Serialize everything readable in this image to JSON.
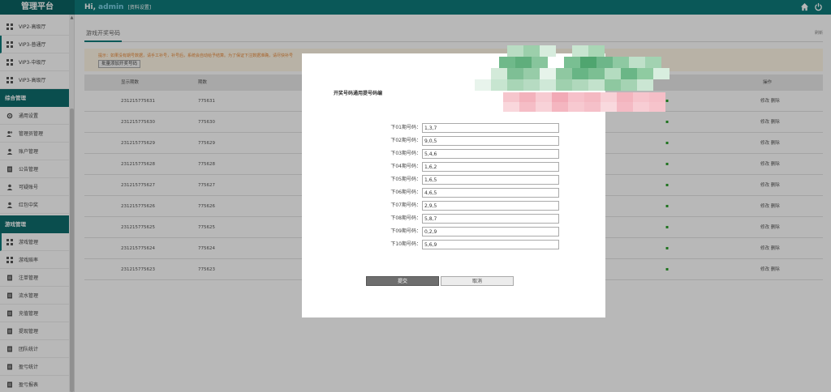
{
  "header": {
    "logo": "管理平台",
    "greeting": "Hi,",
    "username": "admin",
    "profile_link": "[资料设置]"
  },
  "sidebar": {
    "items_top": [
      {
        "label": "VIP2-高级厅",
        "icon": "grid-icon"
      },
      {
        "label": "VIP3-普通厅",
        "icon": "grid-icon",
        "active": true
      },
      {
        "label": "VIP3-中级厅",
        "icon": "grid-icon"
      },
      {
        "label": "VIP3-高级厅",
        "icon": "grid-icon"
      }
    ],
    "section1": "综合管理",
    "items_mid": [
      {
        "label": "通用设置",
        "icon": "gear-icon"
      },
      {
        "label": "管理员管理",
        "icon": "users-icon"
      },
      {
        "label": "账户管理",
        "icon": "user-icon"
      },
      {
        "label": "公告管理",
        "icon": "document-icon"
      },
      {
        "label": "可疑账号",
        "icon": "user-icon"
      },
      {
        "label": "红包中奖",
        "icon": "user-icon"
      }
    ],
    "section2": "游戏管理",
    "items_bottom": [
      {
        "label": "游戏管理",
        "icon": "grid-icon",
        "active": true
      },
      {
        "label": "游戏赔率",
        "icon": "grid-icon"
      },
      {
        "label": "注单管理",
        "icon": "document-icon"
      },
      {
        "label": "流水管理",
        "icon": "document-icon"
      },
      {
        "label": "充值管理",
        "icon": "document-icon"
      },
      {
        "label": "提现管理",
        "icon": "document-icon"
      },
      {
        "label": "团队统计",
        "icon": "document-icon"
      },
      {
        "label": "盈亏统计",
        "icon": "document-icon"
      },
      {
        "label": "盈亏报表",
        "icon": "document-icon"
      }
    ]
  },
  "main": {
    "tab": "游戏开奖号码",
    "refresh": "刷新",
    "tip": "提示：如果没有期号数据，请手工补号，补号后，系统会自动给予结算。为了保证下注数据准确，请尽快补号",
    "batch_button": "批量添加开奖号码",
    "columns": [
      "显示期数",
      "期数",
      "操作"
    ],
    "actions": "修改 删除",
    "rows": [
      {
        "display": "231215775631",
        "period": "775631",
        "state": "▪"
      },
      {
        "display": "231215775630",
        "period": "775630",
        "state": "▪"
      },
      {
        "display": "231215775629",
        "period": "775629",
        "state": "▪"
      },
      {
        "display": "231215775628",
        "period": "775628",
        "state": "▪"
      },
      {
        "display": "231215775627",
        "period": "775627",
        "state": "▪"
      },
      {
        "display": "231215775626",
        "period": "775626",
        "state": "▪"
      },
      {
        "display": "231215775625",
        "period": "775625",
        "state": "▪"
      },
      {
        "display": "231215775624",
        "period": "775624",
        "state": "▪"
      },
      {
        "display": "231215775623",
        "period": "775623",
        "state": "▪"
      }
    ]
  },
  "modal": {
    "title": "开奖号码通用提号码编",
    "fields": [
      {
        "label": "下01期号码：",
        "value": "1,3,7"
      },
      {
        "label": "下02期号码：",
        "value": "9,0,5"
      },
      {
        "label": "下03期号码：",
        "value": "5,4,6"
      },
      {
        "label": "下04期号码：",
        "value": "1,6,2"
      },
      {
        "label": "下05期号码：",
        "value": "1,6,5"
      },
      {
        "label": "下06期号码：",
        "value": "4,6,5"
      },
      {
        "label": "下07期号码：",
        "value": "2,9,5"
      },
      {
        "label": "下08期号码：",
        "value": "5,8,7"
      },
      {
        "label": "下09期号码：",
        "value": "0,2,9"
      },
      {
        "label": "下10期号码：",
        "value": "5,6,9"
      }
    ],
    "submit": "提交",
    "cancel": "取消"
  },
  "colors": {
    "brand": "#0f7a7a",
    "section": "#0f6d6d",
    "tip_text": "#e88a3c",
    "status_green": "#2aa02a"
  }
}
